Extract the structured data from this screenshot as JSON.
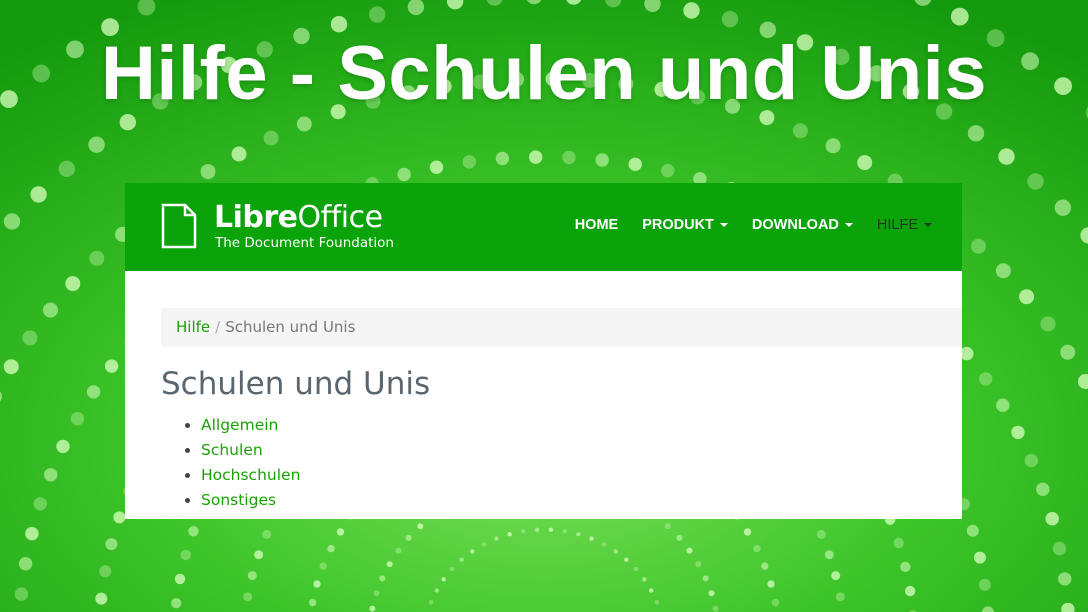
{
  "headline": "Hilfe - Schulen und Unis",
  "colors": {
    "background_green": "#2fb81f",
    "navbar_green": "#0aa30a",
    "link_green": "#18a303",
    "title_gray": "#5a6770",
    "breadcrumb_bg": "#f5f5f5"
  },
  "logo": {
    "name_bold": "Libre",
    "name_regular": "Office",
    "subtitle": "The Document Foundation",
    "icon": "document-page-icon"
  },
  "nav": {
    "items": [
      {
        "label": "HOME",
        "dropdown": false,
        "active": false
      },
      {
        "label": "PRODUKT",
        "dropdown": true,
        "active": false
      },
      {
        "label": "DOWNLOAD",
        "dropdown": true,
        "active": false
      },
      {
        "label": "HILFE",
        "dropdown": true,
        "active": true
      }
    ]
  },
  "breadcrumb": {
    "root": "Hilfe",
    "separator": "/",
    "current": "Schulen und Unis"
  },
  "page": {
    "title": "Schulen und Unis",
    "links": [
      "Allgemein",
      "Schulen",
      "Hochschulen",
      "Sonstiges"
    ]
  }
}
